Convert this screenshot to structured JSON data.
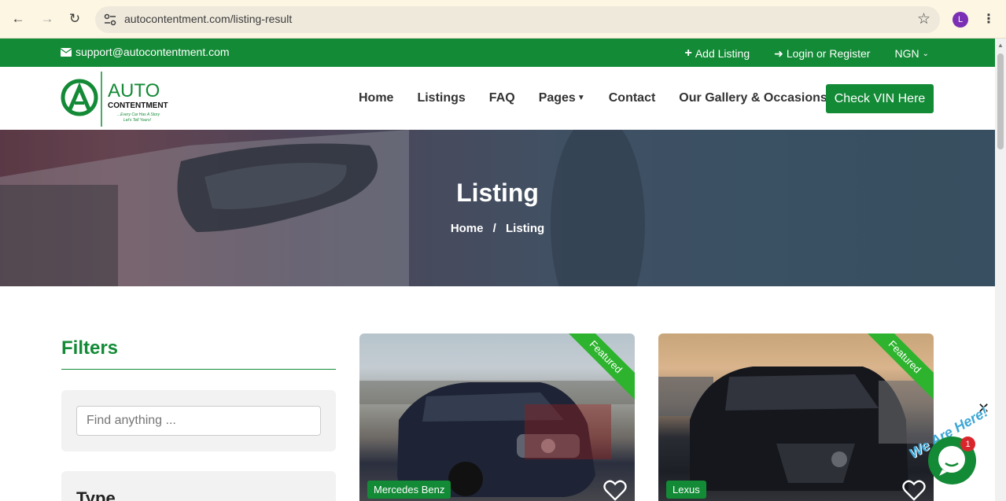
{
  "browser": {
    "url": "autocontentment.com/listing-result",
    "profile_initial": "L"
  },
  "topbar": {
    "email": "support@autocontentment.com",
    "add_listing": "Add Listing",
    "login": "Login or Register",
    "currency": "NGN"
  },
  "logo": {
    "name": "AUTO",
    "sub": "CONTENTMENT",
    "tagline": "...Every Car Has A Story Let's Tell Yours!"
  },
  "nav": {
    "items": [
      "Home",
      "Listings",
      "FAQ",
      "Pages",
      "Contact",
      "Our Gallery & Occasions"
    ],
    "cta": "Check VIN Here"
  },
  "hero": {
    "title": "Listing",
    "crumb_home": "Home",
    "crumb_sep": "/",
    "crumb_current": "Listing"
  },
  "filters": {
    "title": "Filters",
    "search_placeholder": "Find anything ...",
    "type_label": "Type"
  },
  "cards": [
    {
      "ribbon": "Featured",
      "brand": "Mercedes Benz"
    },
    {
      "ribbon": "Featured",
      "brand": "Lexus"
    }
  ],
  "chat": {
    "tagline": "We Are Here!",
    "badge": "1"
  },
  "colors": {
    "brand_green": "#138a36",
    "ribbon_green": "#2db32d",
    "badge_red": "#d9262c"
  }
}
